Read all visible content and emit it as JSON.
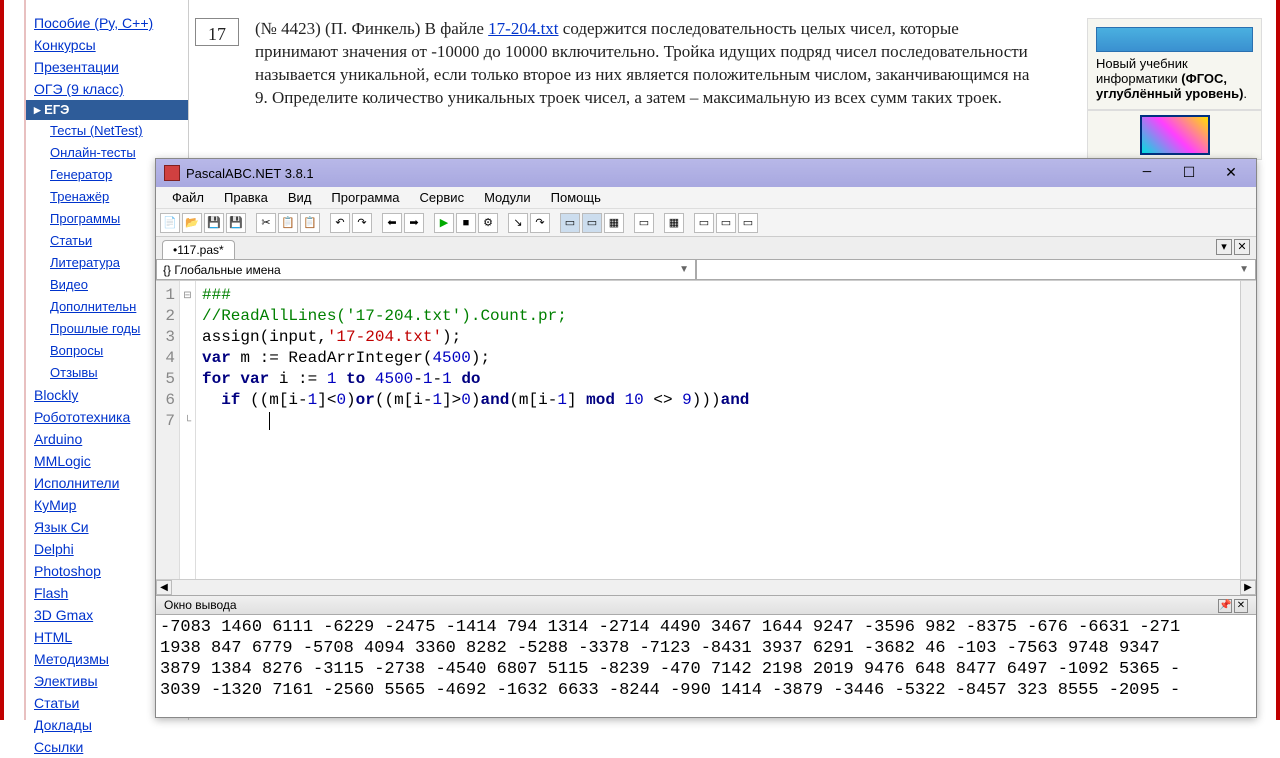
{
  "sidebar": {
    "top": [
      {
        "label": "Пособие (Py, C++)",
        "strike": true
      },
      {
        "label": "Конкурсы"
      },
      {
        "label": "Презентации"
      },
      {
        "label": "ОГЭ (9 класс)"
      }
    ],
    "selected": "▸ ЕГЭ",
    "under": [
      "Тесты (NetTest)",
      "Онлайн-тесты",
      "Генератор",
      "Тренажёр",
      "Программы",
      "Статьи",
      "Литература",
      "Видео",
      "Дополнительн",
      "Прошлые годы",
      "Вопросы",
      "Отзывы"
    ],
    "bottom": [
      "Blockly",
      "Робототехника",
      "Arduino",
      "MMLogic",
      "Исполнители",
      "КуМир",
      "Язык Си",
      "Delphi",
      "Photoshop",
      "Flash",
      "3D Gmax",
      "HTML",
      "Методизмы",
      "Элективы",
      "Статьи",
      "Доклады",
      "Ссылки"
    ]
  },
  "question": {
    "num": "17",
    "prefix": "(№ 4423) (П. Финкель) В файле ",
    "link": "17-204.txt",
    "rest": " содержится последовательность целых чисел, которые принимают значения от -10000 до 10000 включительно. Тройка идущих подряд чисел последовательности называется уникальной, если только второе из них является положительным числом, заканчивающимся на 9. Определите количество уникальных троек чисел, а затем – максимальную из всех сумм таких троек."
  },
  "rbox": {
    "t1": "Новый учебник информатики ",
    "t2": "(ФГОС, углублённый уровень)",
    "dot": "."
  },
  "ide": {
    "title": "PascalABC.NET 3.8.1",
    "menus": [
      "Файл",
      "Правка",
      "Вид",
      "Программа",
      "Сервис",
      "Модули",
      "Помощь"
    ],
    "tab": "•117.pas*",
    "combo1": "{} Глобальные имена",
    "gutter": [
      "1",
      "2",
      "3",
      "4",
      "5",
      "6",
      "7"
    ],
    "code_lines": [
      {
        "t": "cm",
        "txt": "###"
      },
      {
        "t": "cm",
        "txt": "//ReadAllLines('17-204.txt').Count.pr;"
      },
      {
        "html": "assign(input,<span class='st'>'17-204.txt'</span>);"
      },
      {
        "html": "<span class='kw'>var</span> m := ReadArrInteger(<span class='nm'>4500</span>);"
      },
      {
        "html": "<span class='kw'>for</span> <span class='kw'>var</span> i := <span class='nm'>1</span> <span class='kw'>to</span> <span class='nm'>4500</span>-<span class='nm'>1</span>-<span class='nm'>1</span> <span class='kw'>do</span>"
      },
      {
        "html": "  <span class='kw'>if</span> ((m[i-<span class='nm'>1</span>]&lt;<span class='nm'>0</span>)<span class='kw'>or</span>((m[i-<span class='nm'>1</span>]&gt;<span class='nm'>0</span>)<span class='kw'>and</span>(m[i-<span class='nm'>1</span>] <span class='kw'>mod</span> <span class='nm'>10</span> &lt;&gt; <span class='nm'>9</span>)))<span class='kw'>and</span>"
      },
      {
        "html": "       <span class='cursor'></span>"
      }
    ],
    "out_title": "Окно вывода",
    "output": "-7083 1460 6111 -6229 -2475 -1414 794 1314 -2714 4490 3467 1644 9247 -3596 982 -8375 -676 -6631 -271\n1938 847 6779 -5708 4094 3360 8282 -5288 -3378 -7123 -8431 3937 6291 -3682 46 -103 -7563 9748 9347\n3879 1384 8276 -3115 -2738 -4540 6807 5115 -8239 -470 7142 2198 2019 9476 648 8477 6497 -1092 5365 -\n3039 -1320 7161 -2560 5565 -4692 -1632 6633 -8244 -990 1414 -3879 -3446 -5322 -8457 323 8555 -2095 -"
  }
}
